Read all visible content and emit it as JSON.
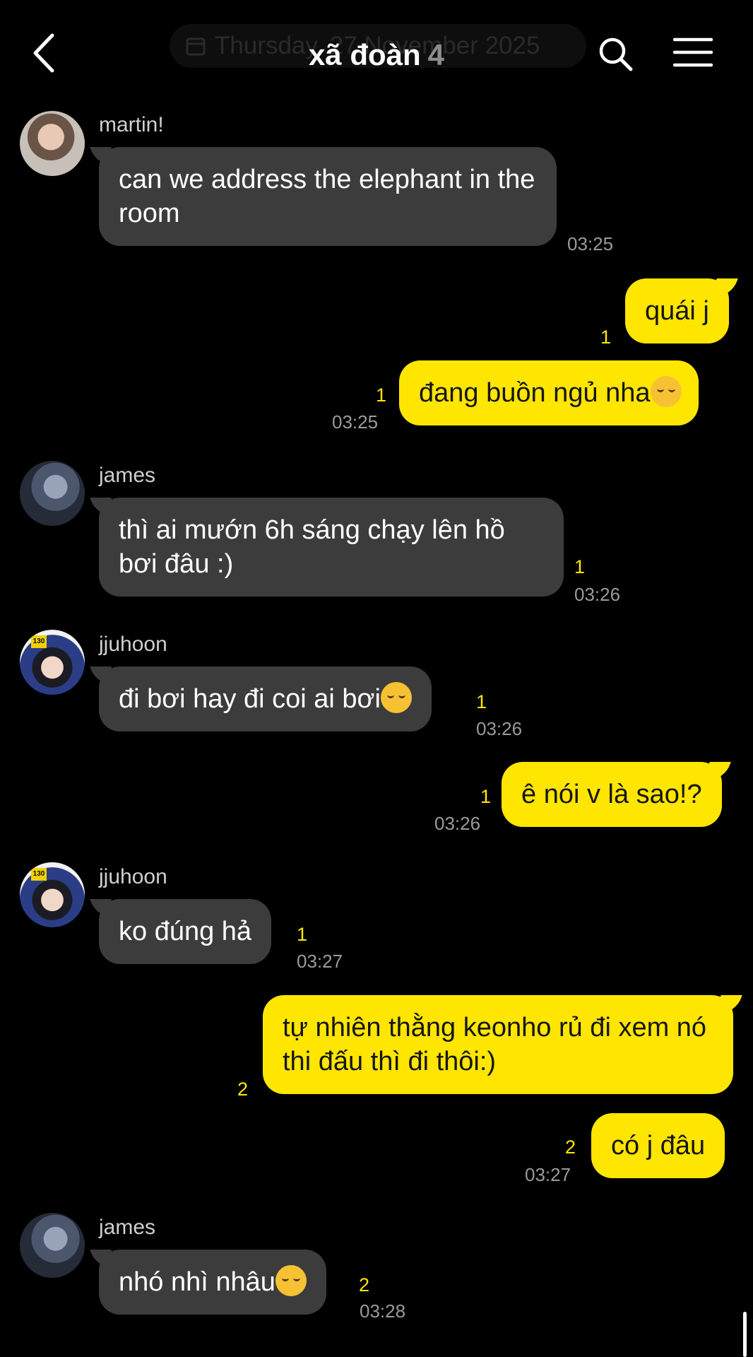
{
  "header": {
    "title": "xã đoàn",
    "member_count": "4",
    "date_pill": "Thursday, 27 November 2025",
    "icons": [
      "back-icon",
      "calendar-icon",
      "search-icon",
      "menu-icon"
    ]
  },
  "messages": [
    {
      "sender": "martin!",
      "text": "can we address the elephant in the room",
      "time": "03:25"
    },
    {
      "text": "quái j",
      "unread": "1"
    },
    {
      "text": "đang buồn ngủ nha",
      "unread": "1",
      "time": "03:25"
    },
    {
      "sender": "james",
      "text": "thì ai mướn 6h sáng chạy lên hồ bơi đâu :)",
      "unread": "1",
      "time": "03:26"
    },
    {
      "sender": "jjuhoon",
      "text": "đi bơi hay đi coi ai bơi",
      "unread": "1",
      "time": "03:26"
    },
    {
      "text": "ê nói v là sao!?",
      "unread": "1",
      "time": "03:26"
    },
    {
      "sender": "jjuhoon",
      "text": "ko đúng hả",
      "unread": "1",
      "time": "03:27"
    },
    {
      "text": "tự nhiên thằng keonho rủ đi xem nó thi đấu thì đi thôi:)",
      "unread": "2"
    },
    {
      "text": "có j đâu",
      "unread": "2",
      "time": "03:27"
    },
    {
      "sender": "james",
      "text": "nhó nhì nhâu",
      "unread": "2",
      "time": "03:28"
    }
  ],
  "avatar_badge": "130",
  "colors": {
    "background": "#000000",
    "incoming_bubble": "#3c3c3c",
    "outgoing_bubble": "#ffe600",
    "unread_count": "#ffe600",
    "timestamp": "#9a9a9a"
  }
}
